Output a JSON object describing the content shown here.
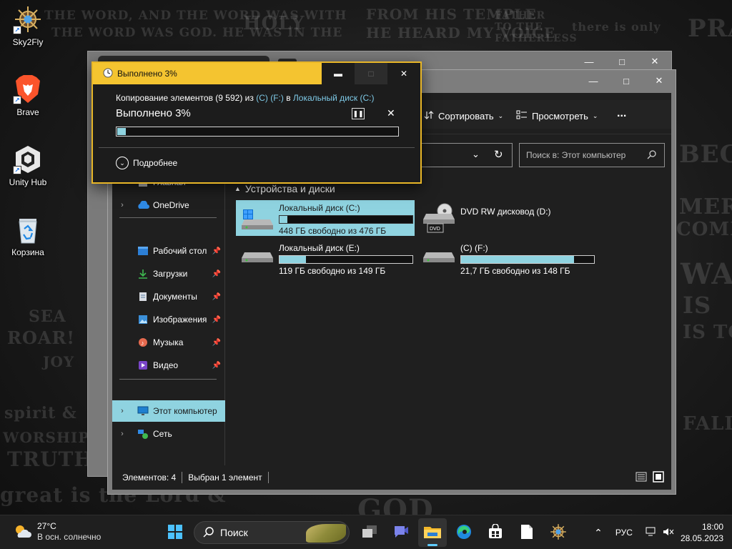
{
  "desktop": {
    "icons": [
      {
        "label": "Sky2Fly"
      },
      {
        "label": "Brave"
      },
      {
        "label": "Unity Hub"
      },
      {
        "label": "Корзина"
      }
    ]
  },
  "wallpaper_texts": [
    "THE WORD, AND THE WORD WAS WITH",
    "THE WORD WAS GOD. HE WAS IN THE",
    "HOLY",
    "FROM HIS TEMPLE",
    "HE HEARD MY VOICE",
    "FATHER TO THE FATHERLESS",
    "there is only",
    "PRA",
    "BECA",
    "MER",
    "COME TO",
    "WA",
    "IS",
    "IS TO C",
    "FALLN",
    "SEA",
    "ROAR!",
    "JOY",
    "spirit &",
    "WORSHIP",
    "TRUTH",
    "great is the Lord &",
    "GOD"
  ],
  "copy_dialog": {
    "title": "Выполнено 3%",
    "line_prefix": "Копирование элементов (9 592) из ",
    "source": "(C) (F:)",
    "line_mid": " в ",
    "destination": "Локальный диск (C:)",
    "status": "Выполнено 3%",
    "progress_percent": 3,
    "details_label": "Подробнее"
  },
  "explorer": {
    "toolbar": {
      "sort_label": "Сортировать",
      "view_label": "Просмотреть",
      "more_label": "..."
    },
    "search_placeholder": "Поиск в: Этот компьютер",
    "nav": {
      "home": "Главная",
      "onedrive": "OneDrive",
      "desktop": "Рабочий стол",
      "downloads": "Загрузки",
      "documents": "Документы",
      "pictures": "Изображения",
      "music": "Музыка",
      "video": "Видео",
      "this_pc": "Этот компьютер",
      "network": "Сеть"
    },
    "group_header": "Устройства и диски",
    "drives": [
      {
        "name": "Локальный диск (C:)",
        "free": "448 ГБ свободно из 476 ГБ",
        "used_fraction": 0.06,
        "selected": true
      },
      {
        "name": "DVD RW дисковод (D:)",
        "free": "",
        "used_fraction": null,
        "selected": false
      },
      {
        "name": "Локальный диск (E:)",
        "free": "119 ГБ свободно из 149 ГБ",
        "used_fraction": 0.2,
        "selected": false
      },
      {
        "name": "(C) (F:)",
        "free": "21,7 ГБ свободно из 148 ГБ",
        "used_fraction": 0.85,
        "selected": false
      }
    ],
    "dvd_label": "DVD",
    "status": {
      "count": "Элементов: 4",
      "selected": "Выбран 1 элемент"
    }
  },
  "taskbar": {
    "weather_temp": "27°C",
    "weather_desc": "В осн. солнечно",
    "search_label": "Поиск",
    "lang": "РУС",
    "time": "18:00",
    "date": "28.05.2023"
  },
  "colors": {
    "accent": "#8fd3e0",
    "dialog_border": "#f4c430",
    "link": "#7ec9e6"
  }
}
